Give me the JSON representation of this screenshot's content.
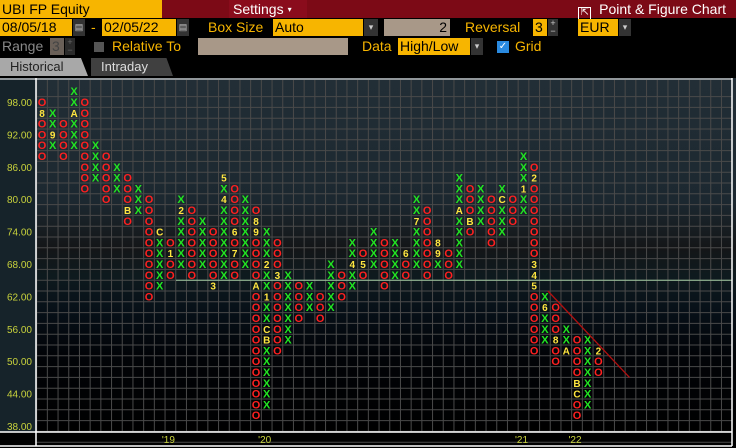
{
  "header": {
    "security": "UBI FP Equity",
    "settings": "Settings",
    "settings_caret": "▾",
    "title": "Point & Figure Chart",
    "export_icon": "⇱"
  },
  "controls": {
    "start_date": "08/05/18",
    "dash": "-",
    "end_date": "02/05/22",
    "box_size_label": "Box Size",
    "box_size": "Auto",
    "box_value": "2",
    "reversal_label": "Reversal",
    "reversal": "3",
    "currency": "EUR",
    "range_label": "Range",
    "range": "3",
    "relative_label": "Relative To",
    "relative_value": "",
    "data_label": "Data",
    "data_value": "High/Low",
    "grid_label": "Grid",
    "grid_checked": true,
    "plus": "+",
    "minus": "−",
    "caret": "▾"
  },
  "tabs": [
    {
      "label": "Historical",
      "active": true
    },
    {
      "label": "Intraday",
      "active": false
    }
  ],
  "colors": {
    "x": "#22e622",
    "o": "#ff2020",
    "month": "#ffe640",
    "axis": "#c8d23c",
    "trend": "#b01010"
  },
  "chart_data": {
    "type": "point-and-figure",
    "box_size": 2,
    "reversal": 3,
    "y_ticks": [
      98,
      92,
      86,
      80,
      74,
      68,
      62,
      56,
      50,
      44,
      38
    ],
    "y_tick_labels": [
      "98.00",
      "92.00",
      "86.00",
      "80.00",
      "74.00",
      "68.00",
      "62.00",
      "56.00",
      "50.00",
      "44.00",
      "38.00"
    ],
    "ylim": [
      38,
      100
    ],
    "x_labels": [
      {
        "label": "'19",
        "col": 12
      },
      {
        "label": "'20",
        "col": 21
      },
      {
        "label": "'21",
        "col": 45
      },
      {
        "label": "'22",
        "col": 50
      }
    ],
    "columns": [
      {
        "t": "O",
        "hi": 98,
        "lo": 88,
        "m": {
          "96": "8"
        }
      },
      {
        "t": "X",
        "hi": 96,
        "lo": 90,
        "m": {
          "92": "9"
        }
      },
      {
        "t": "O",
        "hi": 94,
        "lo": 88,
        "m": {}
      },
      {
        "t": "X",
        "hi": 100,
        "lo": 90,
        "m": {
          "96": "A"
        }
      },
      {
        "t": "O",
        "hi": 98,
        "lo": 82,
        "m": {}
      },
      {
        "t": "X",
        "hi": 90,
        "lo": 84,
        "m": {}
      },
      {
        "t": "O",
        "hi": 88,
        "lo": 80,
        "m": {}
      },
      {
        "t": "X",
        "hi": 86,
        "lo": 82,
        "m": {}
      },
      {
        "t": "O",
        "hi": 84,
        "lo": 76,
        "m": {
          "78": "B"
        }
      },
      {
        "t": "X",
        "hi": 82,
        "lo": 78,
        "m": {}
      },
      {
        "t": "O",
        "hi": 80,
        "lo": 62,
        "m": {}
      },
      {
        "t": "X",
        "hi": 74,
        "lo": 64,
        "m": {
          "74": "C"
        }
      },
      {
        "t": "O",
        "hi": 72,
        "lo": 66,
        "m": {
          "70": "1"
        }
      },
      {
        "t": "X",
        "hi": 80,
        "lo": 68,
        "m": {
          "78": "2"
        }
      },
      {
        "t": "O",
        "hi": 78,
        "lo": 66,
        "m": {}
      },
      {
        "t": "X",
        "hi": 76,
        "lo": 68,
        "m": {}
      },
      {
        "t": "O",
        "hi": 74,
        "lo": 64,
        "m": {
          "64": "3"
        }
      },
      {
        "t": "X",
        "hi": 84,
        "lo": 66,
        "m": {
          "84": "5",
          "80": "4"
        }
      },
      {
        "t": "O",
        "hi": 82,
        "lo": 66,
        "m": {
          "74": "6",
          "70": "7"
        }
      },
      {
        "t": "X",
        "hi": 80,
        "lo": 68,
        "m": {}
      },
      {
        "t": "O",
        "hi": 78,
        "lo": 40,
        "m": {
          "76": "8",
          "74": "9",
          "64": "A"
        }
      },
      {
        "t": "X",
        "hi": 74,
        "lo": 42,
        "m": {
          "68": "2",
          "62": "1",
          "56": "C",
          "54": "B"
        }
      },
      {
        "t": "O",
        "hi": 72,
        "lo": 52,
        "m": {
          "66": "3"
        }
      },
      {
        "t": "X",
        "hi": 66,
        "lo": 54,
        "m": {}
      },
      {
        "t": "O",
        "hi": 64,
        "lo": 58,
        "m": {}
      },
      {
        "t": "X",
        "hi": 64,
        "lo": 60,
        "m": {}
      },
      {
        "t": "O",
        "hi": 62,
        "lo": 58,
        "m": {}
      },
      {
        "t": "X",
        "hi": 68,
        "lo": 60,
        "m": {}
      },
      {
        "t": "O",
        "hi": 66,
        "lo": 62,
        "m": {}
      },
      {
        "t": "X",
        "hi": 72,
        "lo": 64,
        "m": {
          "68": "4"
        }
      },
      {
        "t": "O",
        "hi": 70,
        "lo": 66,
        "m": {
          "68": "5"
        }
      },
      {
        "t": "X",
        "hi": 74,
        "lo": 68,
        "m": {}
      },
      {
        "t": "O",
        "hi": 72,
        "lo": 64,
        "m": {}
      },
      {
        "t": "X",
        "hi": 72,
        "lo": 66,
        "m": {}
      },
      {
        "t": "O",
        "hi": 70,
        "lo": 66,
        "m": {
          "70": "6"
        }
      },
      {
        "t": "X",
        "hi": 80,
        "lo": 68,
        "m": {
          "76": "7"
        }
      },
      {
        "t": "O",
        "hi": 78,
        "lo": 66,
        "m": {}
      },
      {
        "t": "X",
        "hi": 72,
        "lo": 68,
        "m": {
          "72": "8",
          "70": "9"
        }
      },
      {
        "t": "O",
        "hi": 70,
        "lo": 66,
        "m": {}
      },
      {
        "t": "X",
        "hi": 84,
        "lo": 68,
        "m": {
          "78": "A"
        }
      },
      {
        "t": "O",
        "hi": 82,
        "lo": 74,
        "m": {
          "76": "B"
        }
      },
      {
        "t": "X",
        "hi": 82,
        "lo": 76,
        "m": {}
      },
      {
        "t": "O",
        "hi": 80,
        "lo": 72,
        "m": {}
      },
      {
        "t": "X",
        "hi": 82,
        "lo": 74,
        "m": {
          "80": "C"
        }
      },
      {
        "t": "O",
        "hi": 80,
        "lo": 76,
        "m": {}
      },
      {
        "t": "X",
        "hi": 88,
        "lo": 78,
        "m": {
          "82": "1"
        }
      },
      {
        "t": "O",
        "hi": 86,
        "lo": 52,
        "m": {
          "84": "2",
          "68": "3",
          "66": "4",
          "64": "5"
        }
      },
      {
        "t": "X",
        "hi": 62,
        "lo": 54,
        "m": {
          "60": "6"
        }
      },
      {
        "t": "O",
        "hi": 60,
        "lo": 50,
        "m": {
          "54": "8"
        }
      },
      {
        "t": "X",
        "hi": 56,
        "lo": 52,
        "m": {
          "52": "A"
        }
      },
      {
        "t": "O",
        "hi": 54,
        "lo": 40,
        "m": {
          "46": "B",
          "44": "C"
        }
      },
      {
        "t": "X",
        "hi": 54,
        "lo": 42,
        "m": {}
      },
      {
        "t": "O",
        "hi": 52,
        "lo": 48,
        "m": {
          "52": "2"
        }
      }
    ],
    "trend_line": {
      "from": {
        "col": 47,
        "price": 63
      },
      "to": {
        "col": 55,
        "price": 47
      }
    },
    "last_price_line": 65
  }
}
